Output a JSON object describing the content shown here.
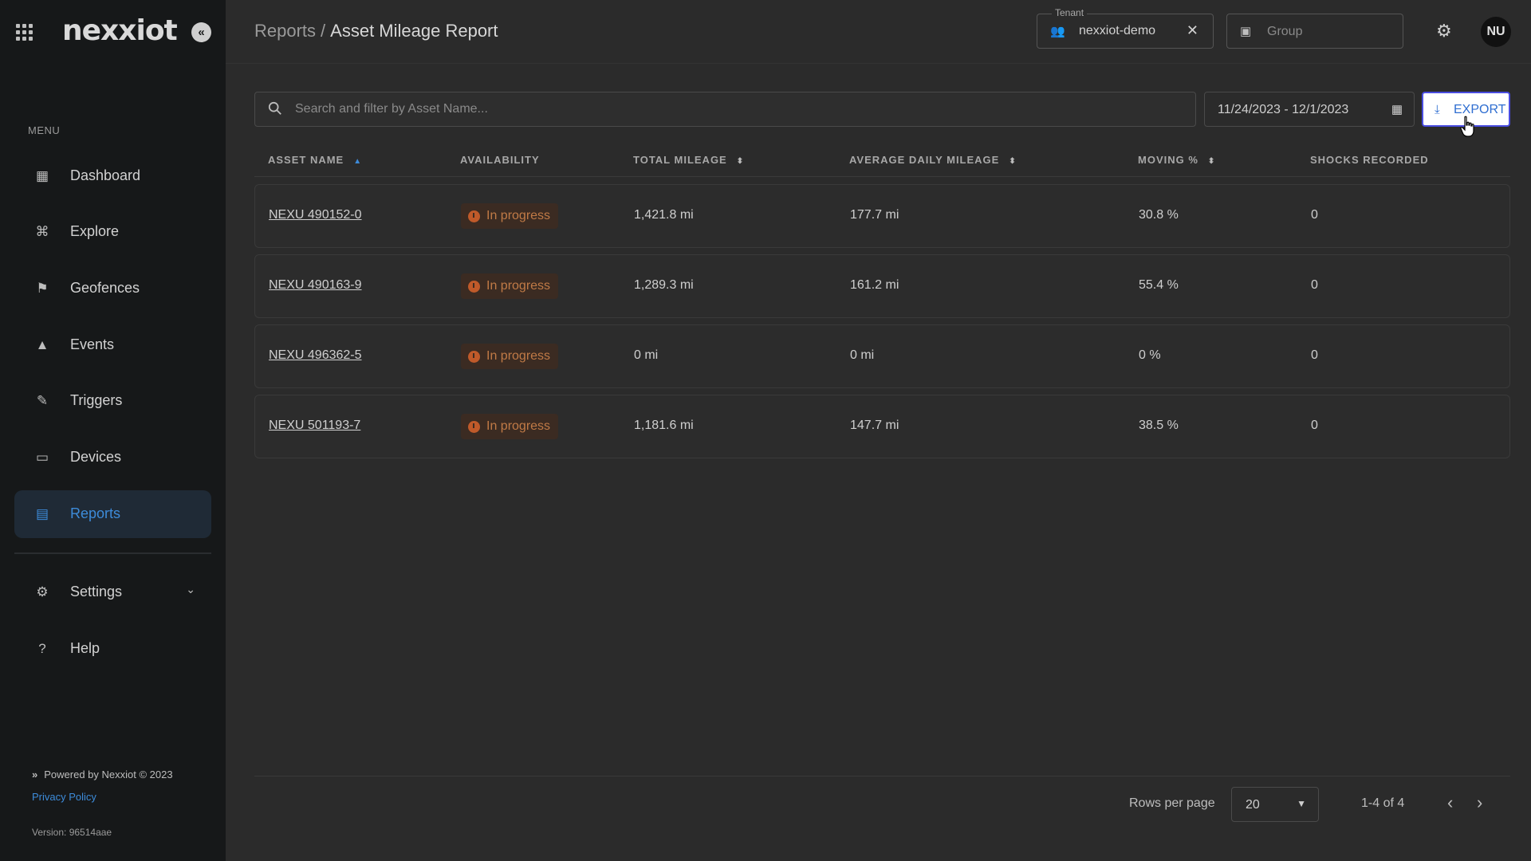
{
  "app": {
    "logo_text": "nexxiot"
  },
  "sidebar": {
    "menu_label": "MENU",
    "items": [
      {
        "label": "Dashboard",
        "icon": "dashboard-icon"
      },
      {
        "label": "Explore",
        "icon": "binoculars-icon"
      },
      {
        "label": "Geofences",
        "icon": "geofence-icon"
      },
      {
        "label": "Events",
        "icon": "warning-icon"
      },
      {
        "label": "Triggers",
        "icon": "pencil-icon"
      },
      {
        "label": "Devices",
        "icon": "cast-icon"
      },
      {
        "label": "Reports",
        "icon": "document-icon",
        "active": true
      }
    ],
    "settings_label": "Settings",
    "help_label": "Help",
    "footer": {
      "powered_by": "Powered by Nexxiot © 2023",
      "privacy": "Privacy Policy",
      "version": "Version: 96514aae"
    }
  },
  "header": {
    "breadcrumb_parent": "Reports",
    "breadcrumb_sep": "/",
    "title": "Asset Mileage Report",
    "tenant": {
      "label": "Tenant",
      "value": "nexxiot-demo"
    },
    "group": {
      "placeholder": "Group"
    },
    "avatar_initials": "NU"
  },
  "toolbar": {
    "search_placeholder": "Search and filter by Asset Name...",
    "date_range": "11/24/2023 - 12/1/2023",
    "export_label": "EXPORT"
  },
  "table": {
    "columns": [
      "ASSET NAME",
      "AVAILABILITY",
      "TOTAL MILEAGE",
      "AVERAGE DAILY MILEAGE",
      "MOVING %",
      "SHOCKS RECORDED"
    ],
    "rows": [
      {
        "asset": "NEXU 490152-0",
        "availability": "In progress",
        "total": "1,421.8 mi",
        "avg": "177.7 mi",
        "moving": "30.8 %",
        "shocks": "0"
      },
      {
        "asset": "NEXU 490163-9",
        "availability": "In progress",
        "total": "1,289.3 mi",
        "avg": "161.2 mi",
        "moving": "55.4 %",
        "shocks": "0"
      },
      {
        "asset": "NEXU 496362-5",
        "availability": "In progress",
        "total": "0 mi",
        "avg": "0 mi",
        "moving": "0 %",
        "shocks": "0"
      },
      {
        "asset": "NEXU 501193-7",
        "availability": "In progress",
        "total": "1,181.6 mi",
        "avg": "147.7 mi",
        "moving": "38.5 %",
        "shocks": "0"
      }
    ]
  },
  "pagination": {
    "rows_per_page_label": "Rows per page",
    "rows_per_page": "20",
    "range": "1-4 of 4"
  },
  "colors": {
    "accent": "#3d8bd9",
    "badge_text": "#c07a46",
    "export_border": "#4a4de0"
  }
}
